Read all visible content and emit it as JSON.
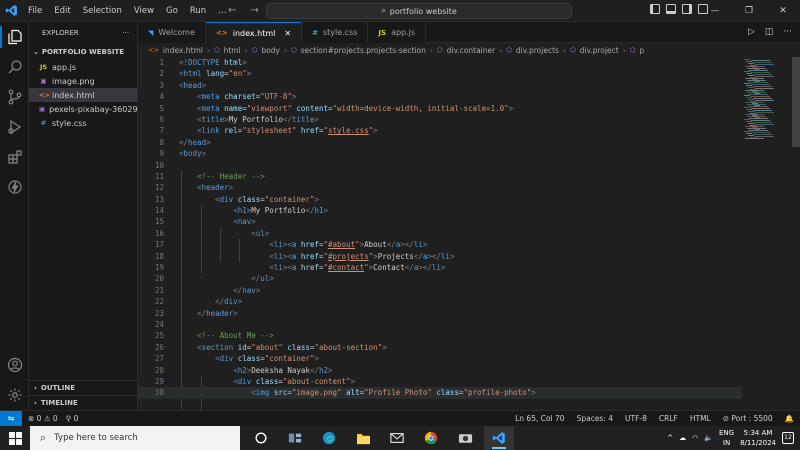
{
  "menu": [
    "File",
    "Edit",
    "Selection",
    "View",
    "Go",
    "Run",
    "…"
  ],
  "command_center": {
    "label": "portfolio website"
  },
  "window": {
    "minimize": "—",
    "restore": "❐",
    "close": "✕"
  },
  "explorer": {
    "title": "EXPLORER",
    "more": "···",
    "folder": "PORTFOLIO WEBSITE",
    "files": [
      {
        "name": "app.js",
        "icon": "JS",
        "color": "#cbcb41"
      },
      {
        "name": "image.png",
        "icon": "▣",
        "color": "#a074c4"
      },
      {
        "name": "index.html",
        "icon": "<>",
        "color": "#e37933",
        "selected": true
      },
      {
        "name": "pexels-pixabay-36029...",
        "icon": "▣",
        "color": "#a074c4"
      },
      {
        "name": "style.css",
        "icon": "#",
        "color": "#519aba"
      }
    ],
    "outline": "OUTLINE",
    "timeline": "TIMELINE"
  },
  "tabs": [
    {
      "name": "Welcome",
      "icon": "◥",
      "color": "#3ea1ff",
      "active": false
    },
    {
      "name": "index.html",
      "icon": "<>",
      "color": "#e37933",
      "active": true,
      "close": "✕"
    },
    {
      "name": "style.css",
      "icon": "#",
      "color": "#519aba",
      "active": false
    },
    {
      "name": "app.js",
      "icon": "JS",
      "color": "#cbcb41",
      "active": false
    }
  ],
  "breadcrumb": [
    "index.html",
    "html",
    "body",
    "section#projects.projects-section",
    "div.container",
    "div.projects",
    "div.project",
    "p"
  ],
  "code": {
    "lines": [
      {
        "n": "1",
        "html": "<span class='p'>&lt;!</span><span class='t'>DOCTYPE</span> <span class='a'>html</span><span class='p'>&gt;</span>"
      },
      {
        "n": "2",
        "html": "<span class='p'>&lt;</span><span class='t'>html</span> <span class='a'>lang</span>=<span class='s'>\"en\"</span><span class='p'>&gt;</span>"
      },
      {
        "n": "3",
        "html": "<span class='p'>&lt;</span><span class='t'>head</span><span class='p'>&gt;</span>"
      },
      {
        "n": "4",
        "html": "    <span class='p'>&lt;</span><span class='t'>meta</span> <span class='a'>charset</span>=<span class='s'>\"UTF-8\"</span><span class='p'>&gt;</span>"
      },
      {
        "n": "5",
        "html": "    <span class='p'>&lt;</span><span class='t'>meta</span> <span class='a'>name</span>=<span class='s'>\"viewport\"</span> <span class='a'>content</span>=<span class='s'>\"width=device-width, initial-scale=1.0\"</span><span class='p'>&gt;</span>"
      },
      {
        "n": "6",
        "html": "    <span class='p'>&lt;</span><span class='t'>title</span><span class='p'>&gt;</span>My Portfolio<span class='p'>&lt;/</span><span class='t'>title</span><span class='p'>&gt;</span>"
      },
      {
        "n": "7",
        "html": "    <span class='p'>&lt;</span><span class='t'>link</span> <span class='a'>rel</span>=<span class='s'>\"stylesheet\"</span> <span class='a'>href</span>=<span class='s'>\"<span class='u'>style.css</span>\"</span><span class='p'>&gt;</span>"
      },
      {
        "n": "8",
        "html": "<span class='p'>&lt;/</span><span class='t'>head</span><span class='p'>&gt;</span>"
      },
      {
        "n": "9",
        "html": "<span class='p'>&lt;</span><span class='t'>body</span><span class='p'>&gt;</span>"
      },
      {
        "n": "10",
        "html": ""
      },
      {
        "n": "11",
        "html": "    <span class='c'>&lt;!-- Header --&gt;</span>"
      },
      {
        "n": "12",
        "html": "    <span class='p'>&lt;</span><span class='t'>header</span><span class='p'>&gt;</span>"
      },
      {
        "n": "13",
        "html": "        <span class='p'>&lt;</span><span class='t'>div</span> <span class='a'>class</span>=<span class='s'>\"container\"</span><span class='p'>&gt;</span>"
      },
      {
        "n": "14",
        "html": "            <span class='p'>&lt;</span><span class='t'>h1</span><span class='p'>&gt;</span>My Portfolio<span class='p'>&lt;/</span><span class='t'>h1</span><span class='p'>&gt;</span>"
      },
      {
        "n": "15",
        "html": "            <span class='p'>&lt;</span><span class='t'>nav</span><span class='p'>&gt;</span>"
      },
      {
        "n": "16",
        "html": "                <span class='p'>&lt;</span><span class='t'>ul</span><span class='p'>&gt;</span>"
      },
      {
        "n": "17",
        "html": "                    <span class='p'>&lt;</span><span class='t'>li</span><span class='p'>&gt;&lt;</span><span class='t'>a</span> <span class='a'>href</span>=<span class='s'>\"<span class='u'>#about</span>\"</span><span class='p'>&gt;</span>About<span class='p'>&lt;/</span><span class='t'>a</span><span class='p'>&gt;&lt;/</span><span class='t'>li</span><span class='p'>&gt;</span>"
      },
      {
        "n": "18",
        "html": "                    <span class='p'>&lt;</span><span class='t'>li</span><span class='p'>&gt;&lt;</span><span class='t'>a</span> <span class='a'>href</span>=<span class='s'>\"<span class='u'>#projects</span>\"</span><span class='p'>&gt;</span>Projects<span class='p'>&lt;/</span><span class='t'>a</span><span class='p'>&gt;&lt;/</span><span class='t'>li</span><span class='p'>&gt;</span>"
      },
      {
        "n": "19",
        "html": "                    <span class='p'>&lt;</span><span class='t'>li</span><span class='p'>&gt;&lt;</span><span class='t'>a</span> <span class='a'>href</span>=<span class='s'>\"<span class='u'>#contact</span>\"</span><span class='p'>&gt;</span>Contact<span class='p'>&lt;/</span><span class='t'>a</span><span class='p'>&gt;&lt;/</span><span class='t'>li</span><span class='p'>&gt;</span>"
      },
      {
        "n": "20",
        "html": "                <span class='p'>&lt;/</span><span class='t'>ul</span><span class='p'>&gt;</span>"
      },
      {
        "n": "21",
        "html": "            <span class='p'>&lt;/</span><span class='t'>nav</span><span class='p'>&gt;</span>"
      },
      {
        "n": "22",
        "html": "        <span class='p'>&lt;/</span><span class='t'>div</span><span class='p'>&gt;</span>"
      },
      {
        "n": "23",
        "html": "    <span class='p'>&lt;/</span><span class='t'>header</span><span class='p'>&gt;</span>"
      },
      {
        "n": "24",
        "html": ""
      },
      {
        "n": "25",
        "html": "    <span class='c'>&lt;!-- About Me --&gt;</span>"
      },
      {
        "n": "26",
        "html": "    <span class='p'>&lt;</span><span class='t'>section</span> <span class='a'>id</span>=<span class='s'>\"about\"</span> <span class='a'>class</span>=<span class='s'>\"about-section\"</span><span class='p'>&gt;</span>"
      },
      {
        "n": "27",
        "html": "        <span class='p'>&lt;</span><span class='t'>div</span> <span class='a'>class</span>=<span class='s'>\"container\"</span><span class='p'>&gt;</span>"
      },
      {
        "n": "28",
        "html": "            <span class='p'>&lt;</span><span class='t'>h2</span><span class='p'>&gt;</span>Deeksha Nayak<span class='p'>&lt;/</span><span class='t'>h2</span><span class='p'>&gt;</span>"
      },
      {
        "n": "29",
        "html": "            <span class='p'>&lt;</span><span class='t'>div</span> <span class='a'>class</span>=<span class='s'>\"about-content\"</span><span class='p'>&gt;</span>"
      },
      {
        "n": "30",
        "html": "                <span class='p'>&lt;</span><span class='t'>img</span> <span class='a'>src</span>=<span class='s'>\"image.png\"</span> <span class='a'>alt</span>=<span class='s'>\"Profile Photo\"</span> <span class='a'>class</span>=<span class='s'>\"profile-photo\"</span><span class='p'>&gt;</span>"
      }
    ]
  },
  "status": {
    "remote": "⇋",
    "problems": "⊗ 0 ⚠ 0",
    "ports_count": "⚲ 0",
    "cursor": "Ln 65, Col 70",
    "spaces": "Spaces: 4",
    "encoding": "UTF-8",
    "eol": "CRLF",
    "language": "HTML",
    "port": "⊘ Port : 5500",
    "bell": "🔔"
  },
  "taskbar": {
    "search_placeholder": "Type here to search",
    "lang": "ENG",
    "region": "IN",
    "time": "5:34 AM",
    "date": "8/11/2024",
    "notifications": "12"
  }
}
